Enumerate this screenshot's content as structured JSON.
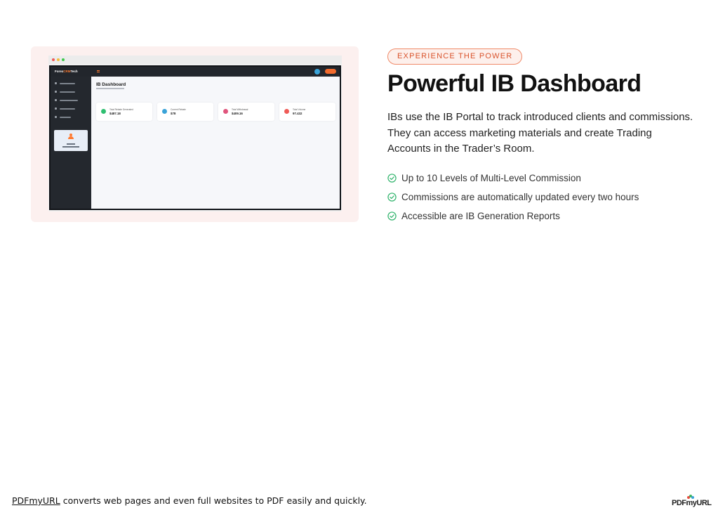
{
  "showcase": {
    "logo_text": "Forex",
    "logo_accent": "CRM",
    "logo_suffix": "Tech",
    "dashboard_title": "IB Dashboard",
    "stats": [
      {
        "label": "Total Rebate Generated",
        "value": "$487.18",
        "icon_color": "#2fbf71"
      },
      {
        "label": "Current Rebate",
        "value": "$78",
        "icon_color": "#3aa3d8"
      },
      {
        "label": "Total Withdrawal",
        "value": "$409.16",
        "icon_color": "#e0557d"
      },
      {
        "label": "Total Volume",
        "value": "97.432",
        "icon_color": "#ef5b57"
      }
    ]
  },
  "content": {
    "badge": "EXPERIENCE THE POWER",
    "headline": "Powerful IB Dashboard",
    "description": "IBs use the IB Portal to track introduced clients and commissions. They can access marketing materials and create Trading Accounts in the Trader’s Room.",
    "features": [
      "Up to 10 Levels of Multi-Level Commission",
      "Commissions are automatically updated every two hours",
      "Accessible are IB Generation Reports"
    ]
  },
  "footer": {
    "link_text": "PDFmyURL",
    "text": " converts web pages and even full websites to PDF easily and quickly.",
    "logo_text": "PDFmyURL"
  },
  "colors": {
    "accent": "#f26a2c",
    "check": "#2fb36b",
    "badge_text": "#d9532c"
  }
}
